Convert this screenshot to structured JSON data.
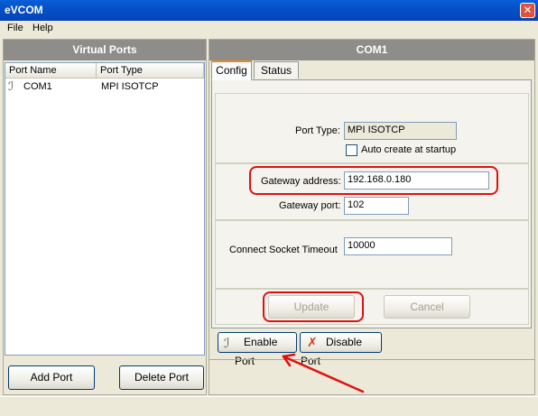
{
  "window": {
    "title": "eVCOM",
    "close_glyph": "✕"
  },
  "menu": {
    "file": "File",
    "help": "Help"
  },
  "left_panel": {
    "header": "Virtual Ports",
    "columns": [
      "Port Name",
      "Port Type"
    ],
    "rows": [
      {
        "name": "COM1",
        "type": "MPI ISOTCP",
        "icon": "port-plug-icon"
      }
    ],
    "add_button": "Add Port",
    "delete_button": "Delete Port"
  },
  "right_panel": {
    "header": "COM1",
    "tabs": [
      "Config",
      "Status"
    ],
    "active_tab": "Config",
    "port_type_label": "Port Type:",
    "port_type_value": "MPI ISOTCP",
    "auto_create_label": "Auto create at startup",
    "auto_create_checked": false,
    "gateway_address_label": "Gateway address:",
    "gateway_address_value": "192.168.0.180",
    "gateway_port_label": "Gateway port:",
    "gateway_port_value": "102",
    "socket_timeout_label": "Connect  Socket Timeout",
    "socket_timeout_value": "10000",
    "update_button": "Update",
    "cancel_button": "Cancel",
    "enable_port_button": "Enable Port",
    "disable_port_button": "Disable Port"
  },
  "colors": {
    "annotation": "#e01010",
    "titlebar": "#0551c9",
    "panel_header": "#8e8d8a"
  }
}
